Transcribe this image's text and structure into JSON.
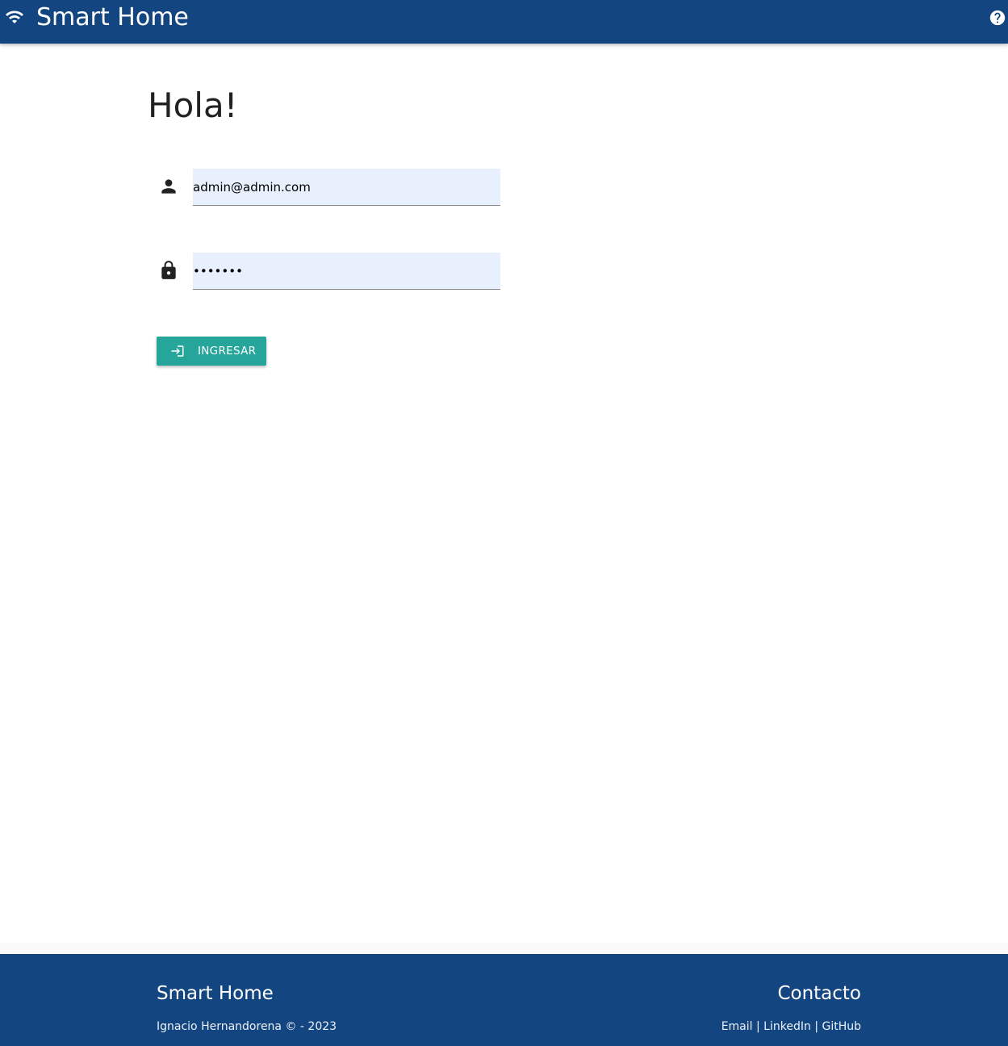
{
  "header": {
    "title": "Smart Home",
    "logo_icon": "wifi-icon",
    "help_icon": "help-circle-icon",
    "background": "#134580"
  },
  "main": {
    "greeting": "Hola!",
    "email_field": {
      "icon": "person-icon",
      "value": "admin@admin.com",
      "background": "#e8f0fe"
    },
    "password_field": {
      "icon": "lock-icon",
      "value": "•••••••"
    },
    "login_button": {
      "icon": "login-icon",
      "label": "INGRESAR",
      "color": "#26a69a"
    }
  },
  "footer": {
    "title": "Smart Home",
    "copyright": "Ignacio Hernandorena © - 2023",
    "contact_title": "Contacto",
    "links": [
      "Email",
      "LinkedIn",
      "GitHub"
    ],
    "separator": "|"
  }
}
